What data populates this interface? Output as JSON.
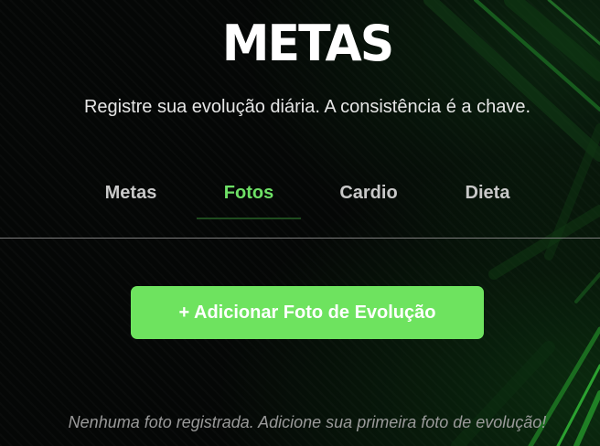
{
  "header": {
    "title": "METAS",
    "subtitle": "Registre sua evolução diária. A consistência é a chave."
  },
  "tabs": [
    {
      "label": "Metas",
      "active": false
    },
    {
      "label": "Fotos",
      "active": true
    },
    {
      "label": "Cardio",
      "active": false
    },
    {
      "label": "Dieta",
      "active": false
    }
  ],
  "photos": {
    "add_button_label": "+ Adicionar Foto de Evolução",
    "empty_message": "Nenhuma foto registrada. Adicione sua primeira foto de evolução!"
  },
  "colors": {
    "accent": "#6ee35f",
    "active_tab": "#6ee066",
    "background": "#050706"
  }
}
